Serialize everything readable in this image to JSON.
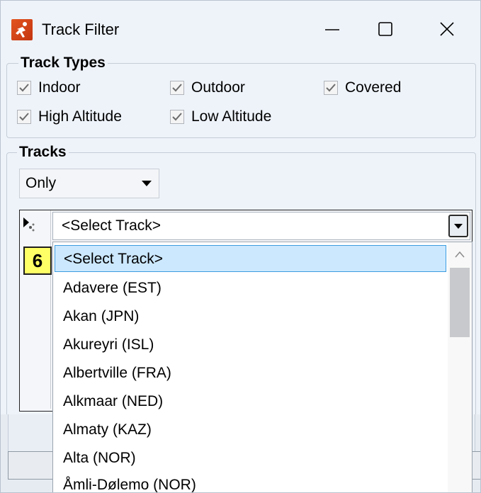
{
  "window": {
    "title": "Track Filter",
    "app_icon": "skater-icon",
    "controls": [
      "minimize-icon",
      "maximize-icon",
      "close-icon"
    ]
  },
  "track_types": {
    "legend": "Track Types",
    "options": [
      {
        "label": "Indoor",
        "checked": true
      },
      {
        "label": "Outdoor",
        "checked": true
      },
      {
        "label": "Covered",
        "checked": true
      },
      {
        "label": "High Altitude",
        "checked": true
      },
      {
        "label": "Low Altitude",
        "checked": true
      }
    ]
  },
  "tracks": {
    "legend": "Tracks",
    "mode_value": "Only",
    "combo_value": "<Select Track>",
    "dropdown_items": [
      "<Select Track>",
      "Adavere (EST)",
      "Akan (JPN)",
      "Akureyri (ISL)",
      "Albertville (FRA)",
      "Alkmaar (NED)",
      "Almaty (KAZ)",
      "Alta (NOR)",
      "Åmli-Dølemo (NOR)"
    ],
    "selected_index": 0
  },
  "step_badge": "6",
  "colors": {
    "selection_bg": "#cce8ff",
    "selection_border": "#3c9ce0",
    "badge_bg": "#ffff66",
    "app_icon": "#e2551f"
  }
}
